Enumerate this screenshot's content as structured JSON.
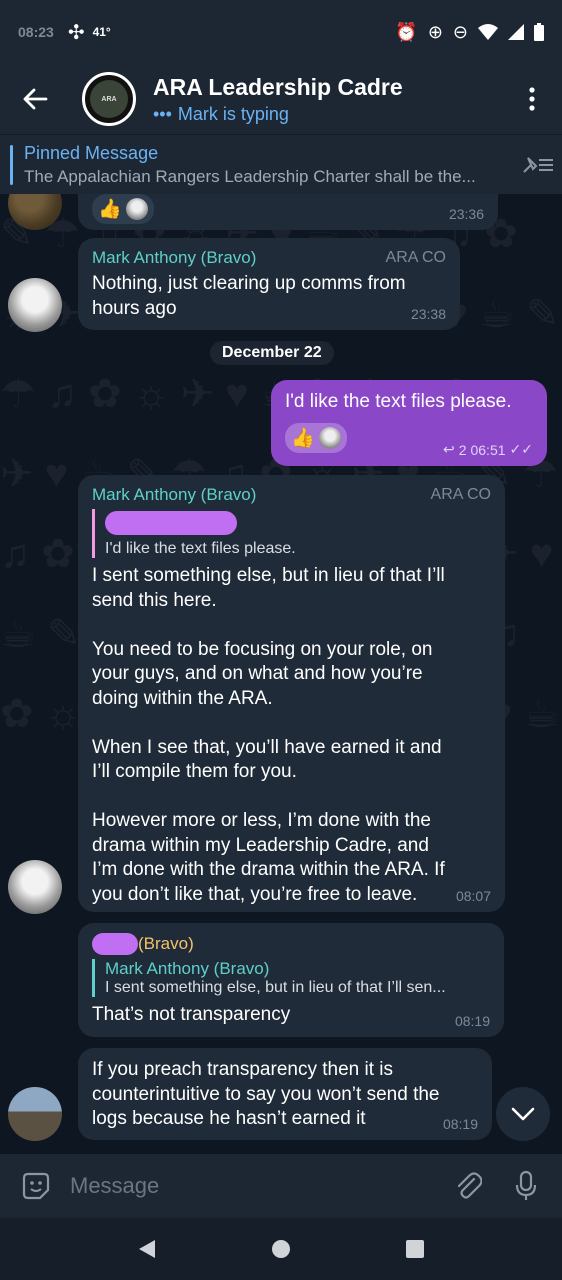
{
  "status_bar": {
    "time": "08:23",
    "temperature": "41°"
  },
  "header": {
    "title": "ARA Leadership Cadre",
    "subtitle": "Mark is typing",
    "avatar_label": "ARA"
  },
  "pinned": {
    "label": "Pinned Message",
    "text": "The Appalachian Rangers Leadership Charter shall be the..."
  },
  "messages": {
    "m0": {
      "time": "23:36"
    },
    "m1": {
      "sender": "Mark Anthony (Bravo)",
      "role": "ARA CO",
      "text": "Nothing, just clearing up comms from\nhours ago",
      "time": "23:38"
    },
    "date_divider": "December 22",
    "m2": {
      "text": "I'd like the text files please.",
      "reply_count": "2",
      "time": "06:51"
    },
    "m3": {
      "sender": "Mark Anthony (Bravo)",
      "role": "ARA CO",
      "quote_text": "I'd like the text files please.",
      "text": "I sent something else, but in lieu of that I’ll\nsend this here.\n\nYou need to be focusing on your role, on\nyour guys, and on what and how you’re\ndoing within the ARA.\n\nWhen I see that, you’ll have earned it and\nI’ll compile them for you.\n\nHowever more or less, I’m done with the\ndrama within my Leadership Cadre, and\nI’m done with the drama within the ARA. If\nyou don’t like that, you’re free to leave.",
      "time": "08:07"
    },
    "m4": {
      "sender_suffix": "(Bravo)",
      "quote_name": "Mark Anthony (Bravo)",
      "quote_text": "I sent something else, but in lieu of that I’ll sen...",
      "text": "That’s not transparency",
      "time": "08:19"
    },
    "m5": {
      "text": "If you preach transparency then it is\ncounterintuitive to say you won’t send the\nlogs because he hasn’t earned it",
      "time": "08:19"
    }
  },
  "composer": {
    "placeholder": "Message"
  },
  "colors": {
    "accent": "#6ab2f2",
    "outgoing_bubble": "#8a47c7",
    "incoming_bubble": "#1f2b38",
    "sender_name": "#5fd0c9",
    "redaction": "#c16ff2"
  }
}
